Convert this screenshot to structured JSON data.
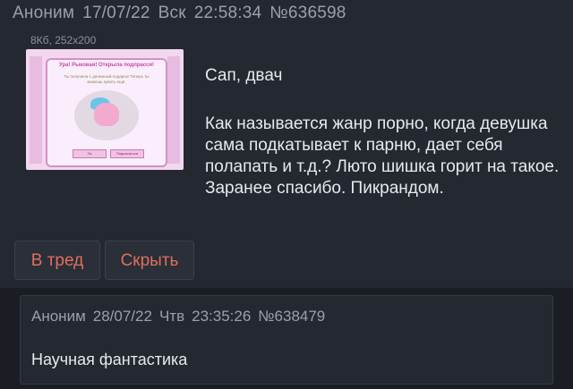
{
  "post": {
    "author": "Аноним",
    "date": "17/07/22",
    "weekday": "Вск",
    "time": "22:58:34",
    "number": "№636598",
    "file_meta": "8Кб, 252x200",
    "thumbnail": {
      "title": "Ура! Рыковая! Открыла подпрасся!",
      "body": "Ты получила 1 денежный подарок! Теперь ты можешь купить ещё.",
      "button_ok": "Ок",
      "button_more": "Подписаться"
    },
    "greeting": "Сап, двач",
    "text": "Как называется жанр порно, когда девушка сама подкатывает к парню, дает себя полапать и т.д.? Люто шишка горит на такое. Заранее спасибо. Пикрандом.",
    "buttons": {
      "to_thread": "В тред",
      "hide": "Скрыть"
    }
  },
  "reply": {
    "author": "Аноним",
    "date": "28/07/22",
    "weekday": "Чтв",
    "time": "23:35:26",
    "number": "№638479",
    "text": "Научная фантастика"
  },
  "colors": {
    "background": "#1a1d24",
    "panel": "#242831",
    "accent": "#e06e5e",
    "meta_text": "#9aa0a8"
  }
}
